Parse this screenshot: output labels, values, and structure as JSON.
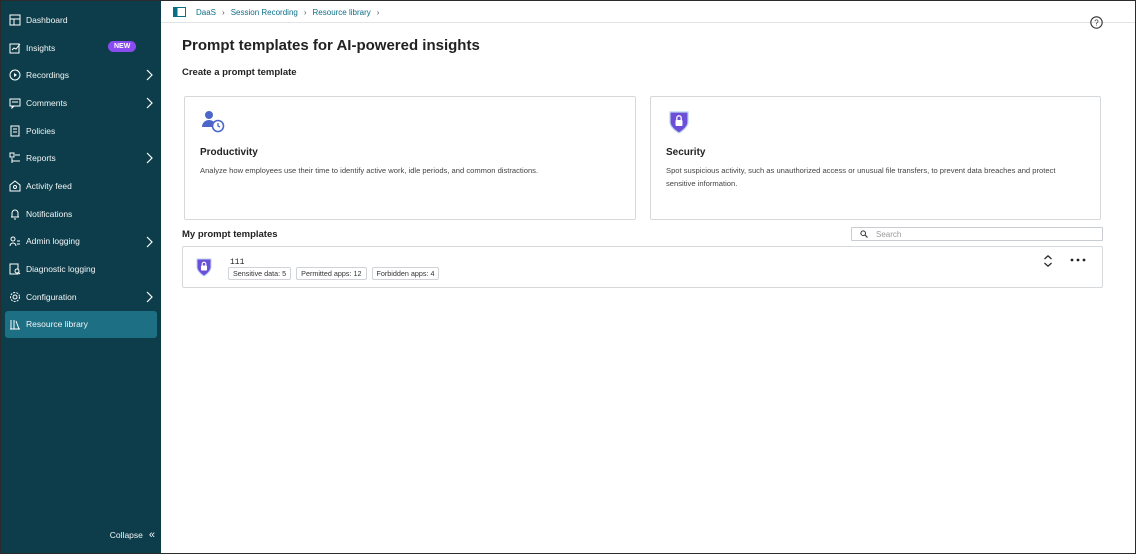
{
  "sidebar": {
    "items": [
      {
        "label": "Dashboard",
        "icon": "dashboard-icon"
      },
      {
        "label": "Insights",
        "icon": "insights-icon",
        "badge": "NEW"
      },
      {
        "label": "Recordings",
        "icon": "recordings-icon",
        "has_chevron": true
      },
      {
        "label": "Comments",
        "icon": "comments-icon",
        "has_chevron": true
      },
      {
        "label": "Policies",
        "icon": "policies-icon"
      },
      {
        "label": "Reports",
        "icon": "reports-icon",
        "has_chevron": true
      },
      {
        "label": "Activity feed",
        "icon": "activity-feed-icon"
      },
      {
        "label": "Notifications",
        "icon": "bell-icon"
      },
      {
        "label": "Admin logging",
        "icon": "admin-logging-icon",
        "has_chevron": true
      },
      {
        "label": "Diagnostic logging",
        "icon": "diagnostic-logging-icon"
      },
      {
        "label": "Configuration",
        "icon": "gear-icon",
        "has_chevron": true
      },
      {
        "label": "Resource library",
        "icon": "library-icon",
        "active": true
      }
    ],
    "collapse_label": "Collapse"
  },
  "breadcrumb": [
    "DaaS",
    "Session Recording",
    "Resource library"
  ],
  "page": {
    "title": "Prompt templates for AI-powered insights",
    "create_heading": "Create a prompt template",
    "my_heading": "My prompt templates"
  },
  "cards": [
    {
      "title": "Productivity",
      "description": "Analyze how employees use their time to identify active work, idle periods, and common distractions.",
      "icon": "productivity-icon"
    },
    {
      "title": "Security",
      "description": "Spot suspicious activity, such as unauthorized access or unusual file transfers, to prevent data breaches and protect sensitive information.",
      "icon": "security-shield-icon"
    }
  ],
  "search": {
    "placeholder": "Search"
  },
  "templates": [
    {
      "name": "111",
      "tags": [
        "Sensitive data: 5",
        "Permitted apps: 12",
        "Forbidden apps: 4"
      ],
      "icon": "security-shield-icon"
    }
  ],
  "colors": {
    "sidebar_bg": "#0d3d4a",
    "active_item": "#1d6f84",
    "badge": "#8a4cf0",
    "link": "#0b6e88",
    "shield": "#6b4fd8"
  }
}
